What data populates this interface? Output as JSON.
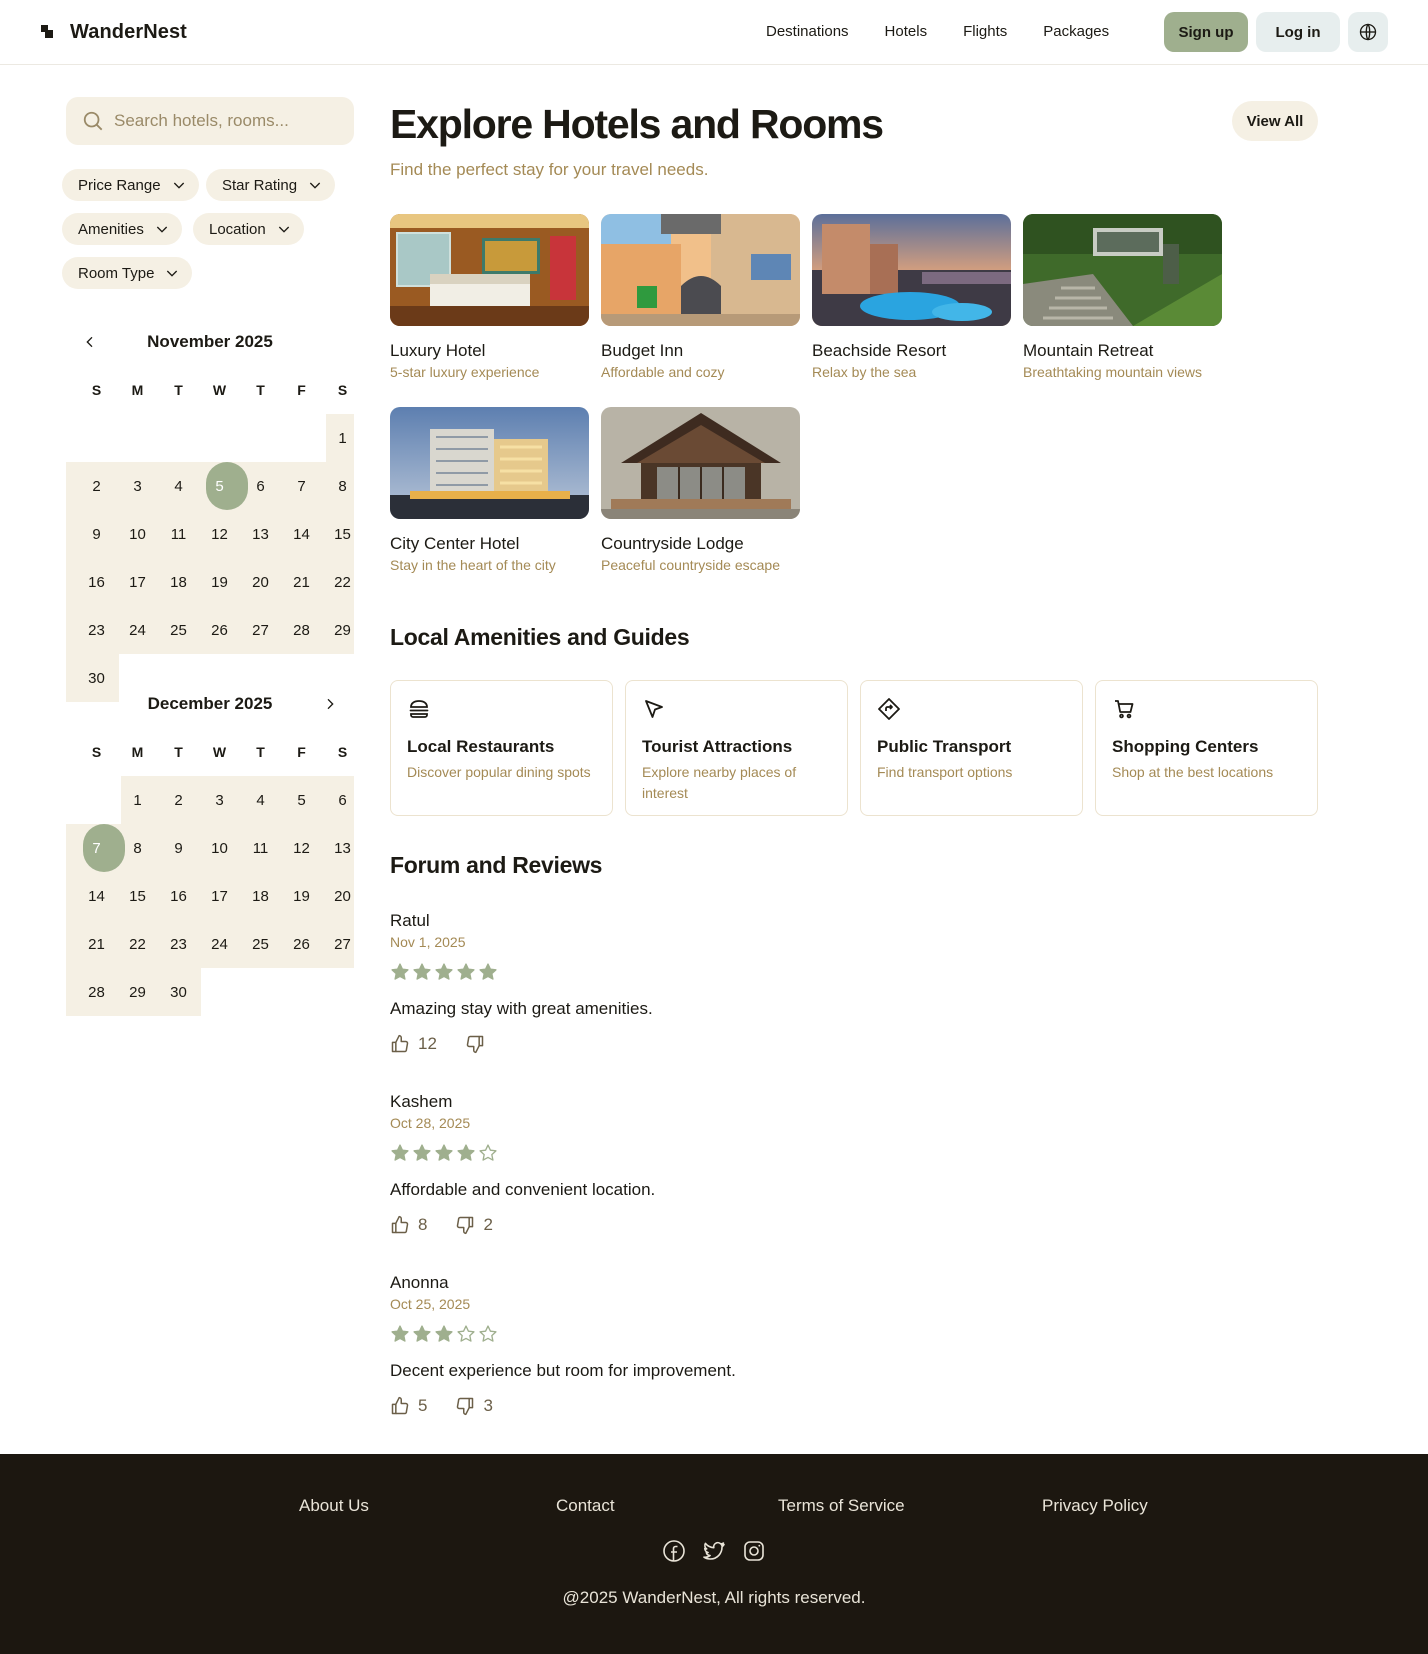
{
  "header": {
    "brand": "WanderNest",
    "nav": [
      "Destinations",
      "Hotels",
      "Flights",
      "Packages"
    ],
    "signup_label": "Sign up",
    "login_label": "Log in"
  },
  "sidebar": {
    "search_placeholder": "Search hotels, rooms...",
    "filters": [
      "Price Range",
      "Star Rating",
      "Amenities",
      "Location",
      "Room Type"
    ],
    "weekdays": [
      "S",
      "M",
      "T",
      "W",
      "T",
      "F",
      "S"
    ],
    "calendars": [
      {
        "title": "November 2025",
        "first_weekday": 6,
        "days": 30,
        "selected_day": 5
      },
      {
        "title": "December 2025",
        "first_weekday": 1,
        "days": 30,
        "selected_day": 7
      }
    ]
  },
  "main": {
    "title": "Explore Hotels and Rooms",
    "subtitle": "Find the perfect stay for your travel needs.",
    "view_all_label": "View All",
    "hotels": [
      {
        "name": "Luxury Hotel",
        "desc": "5-star luxury experience"
      },
      {
        "name": "Budget Inn",
        "desc": "Affordable and cozy"
      },
      {
        "name": "Beachside Resort",
        "desc": "Relax by the sea"
      },
      {
        "name": "Mountain Retreat",
        "desc": "Breathtaking mountain views"
      },
      {
        "name": "City Center Hotel",
        "desc": "Stay in the heart of the city"
      },
      {
        "name": "Countryside Lodge",
        "desc": "Peaceful countryside escape"
      }
    ],
    "amenities_title": "Local Amenities and Guides",
    "amenities": [
      {
        "icon": "burger-icon",
        "title": "Local Restaurants",
        "desc": "Discover popular dining spots"
      },
      {
        "icon": "navigation-arrow-icon",
        "title": "Tourist Attractions",
        "desc": "Explore nearby places of interest"
      },
      {
        "icon": "directions-sign-icon",
        "title": "Public Transport",
        "desc": "Find transport options"
      },
      {
        "icon": "shopping-cart-icon",
        "title": "Shopping Centers",
        "desc": "Shop at the best locations"
      }
    ],
    "reviews_title": "Forum and Reviews",
    "reviews": [
      {
        "author": "Ratul",
        "date": "Nov 1, 2025",
        "rating": 5,
        "text": "Amazing stay with great amenities.",
        "likes": "12",
        "dislikes": ""
      },
      {
        "author": "Kashem",
        "date": "Oct 28, 2025",
        "rating": 4,
        "text": "Affordable and convenient location.",
        "likes": "8",
        "dislikes": "2"
      },
      {
        "author": "Anonna",
        "date": "Oct 25, 2025",
        "rating": 3,
        "text": "Decent experience but room for improvement.",
        "likes": "5",
        "dislikes": "3"
      }
    ]
  },
  "footer": {
    "links": [
      "About Us",
      "Contact",
      "Terms of Service",
      "Privacy Policy"
    ],
    "social": [
      "facebook-icon",
      "twitter-icon",
      "instagram-icon"
    ],
    "copyright": "@2025 WanderNest, All rights reserved."
  },
  "colors": {
    "accent": "#9faf8e",
    "muted_text": "#a48a55",
    "chip_bg": "#f5f0e4",
    "footer_bg": "#1c1710"
  }
}
